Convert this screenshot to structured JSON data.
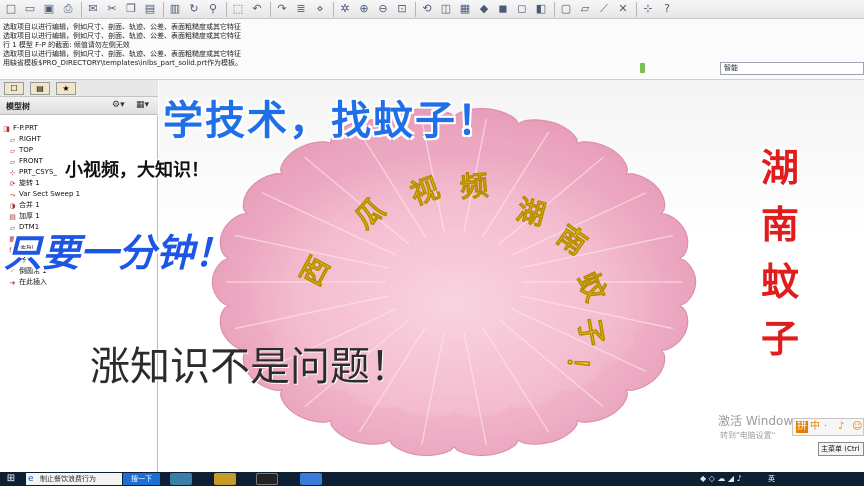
{
  "toolbar": {
    "icons": [
      "new-icon",
      "open-icon",
      "save-icon",
      "print-icon",
      "email-icon",
      "cut-icon",
      "copy-icon",
      "paste-icon",
      "paste-special-icon",
      "regenerate-icon",
      "find-icon",
      "select-box-icon",
      "undo-icon",
      "redo-icon",
      "layer-icon",
      "datum-icon",
      "spin-icon",
      "zoom-in-icon",
      "zoom-out-icon",
      "refit-icon",
      "orient-icon",
      "view-manager-icon",
      "saved-views-icon",
      "display-style-icon",
      "shading-icon",
      "no-hidden-icon",
      "hidden-line-icon",
      "wireframe-icon",
      "datum-planes-icon",
      "datum-axes-icon",
      "datum-points-icon",
      "coordinate-systems-icon",
      "help-icon"
    ]
  },
  "messages": [
    "选取项目以进行编辑，例如尺寸、剖面、轨迹、公差、表面粗糙度或其它特征",
    "选取项目以进行编辑，例如尺寸、剖面、轨迹、公差、表面粗糙度或其它特征",
    "行 1 模型 F-P 的截面: 倾值请勿左侧无效",
    "选取项目以进行编辑，例如尺寸、剖面、轨迹、公差、表面粗糙度或其它特征",
    "用缺省模板$PRO_DIRECTORY\\templates\\inlbs_part_solid.prt作为模板。"
  ],
  "smart_filter": "智能",
  "model_tree": {
    "title": "模型树",
    "items": [
      {
        "label": "F-P.PRT",
        "icon": "part-icon"
      },
      {
        "label": "RIGHT",
        "icon": "datum-plane-icon"
      },
      {
        "label": "TOP",
        "icon": "datum-plane-icon"
      },
      {
        "label": "FRONT",
        "icon": "datum-plane-icon"
      },
      {
        "label": "PRT_CSYS_",
        "icon": "csys-icon"
      },
      {
        "label": "旋转 1",
        "icon": "revolve-icon"
      },
      {
        "label": "Var Sect Sweep 1",
        "icon": "sweep-icon"
      },
      {
        "label": "合并 1",
        "icon": "merge-icon"
      },
      {
        "label": "加厚 1",
        "icon": "thicken-icon"
      },
      {
        "label": "DTM1",
        "icon": "datum-plane-icon"
      },
      {
        "label": "阵列",
        "icon": "pattern-icon"
      },
      {
        "label": "阵列",
        "icon": "pattern-icon"
      },
      {
        "label": "移",
        "icon": "move-icon"
      },
      {
        "label": "倒圆角 1",
        "icon": "round-icon"
      },
      {
        "label": "在此插入",
        "icon": "insert-here-icon"
      }
    ]
  },
  "overlay": {
    "title": "学技术，找蚊子！",
    "small": "小视频，大知识！",
    "minute": "只要一分钟！",
    "knowledge": "涨知识不是问题！",
    "vertical": "湖南蚊子",
    "bowl_left": "西瓜视频",
    "bowl_right": "湖南蚊子！"
  },
  "windows_notice": {
    "line1": "激活 Windows",
    "line2": "转到\"电脑设置\""
  },
  "ime_bar": [
    "拼",
    "中",
    "·",
    "♪",
    "☺"
  ],
  "menu_button": "主菜单 (Ctrl",
  "taskbar": {
    "search_placeholder": "制止餐饮浪费行为",
    "search_button": "搜一下",
    "tray_text": "英"
  },
  "colors": {
    "bowl": "#f2b8cd",
    "bowl_rim": "#e89fba",
    "title_blue": "#1f6fe8",
    "vertical_red": "#e01c1c",
    "bowl_text_yellow": "#f5e000"
  }
}
